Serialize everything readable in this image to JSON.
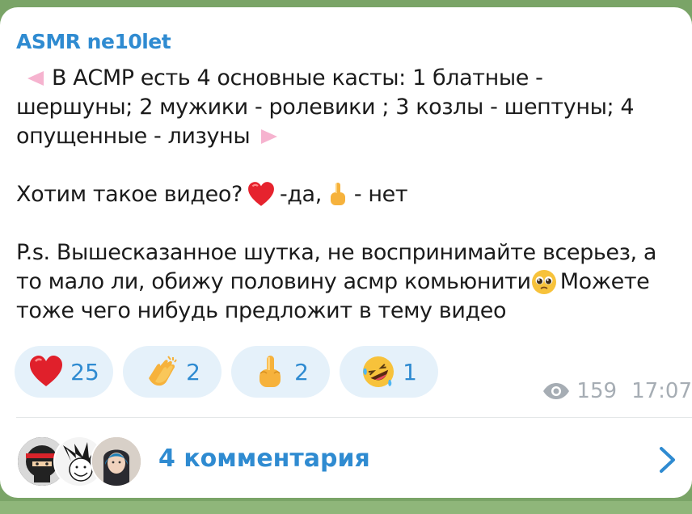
{
  "message": {
    "channel_name": "ASMR ne10let",
    "lines": [
      "В АСМР есть 4 основные касты: 1 блатные -",
      "шершуны; 2 мужики - ролевики ; 3 козлы - шептуны; 4",
      "опущенные - лизуны",
      "Хотим такое видео?",
      "-да,",
      "- нет",
      "P.s. Вышесказанное шутка, не воспринимайте всерьез, а",
      "то мало ли, обижу половину асмр комьюнити",
      "Можете",
      "тоже чего нибудь предложит в тему видео"
    ],
    "icons": {
      "left": "triangle-left-icon",
      "right": "triangle-right-icon",
      "heart": "red-heart-icon",
      "finger": "middle-finger-icon",
      "pleading": "pleading-face-icon"
    }
  },
  "reactions": [
    {
      "icon": "red-heart-icon",
      "count": "25"
    },
    {
      "icon": "clapping-hands-icon",
      "count": "2"
    },
    {
      "icon": "middle-finger-icon",
      "count": "2"
    },
    {
      "icon": "rofl-face-icon",
      "count": "1"
    }
  ],
  "meta": {
    "views": "159",
    "time": "17:07",
    "views_icon": "eye-icon"
  },
  "comments": {
    "label": "4 комментария",
    "chevron_icon": "chevron-right-icon"
  },
  "colors": {
    "accent": "#2f8bd1",
    "reaction_bg": "#e5f1fa",
    "background": "#7aa467"
  }
}
